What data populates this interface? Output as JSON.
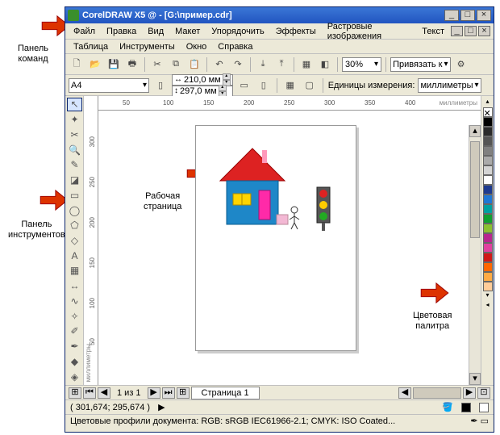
{
  "titlebar": {
    "title": "CorelDRAW X5 @ - [G:\\пример.cdr]"
  },
  "menu": [
    "Файл",
    "Правка",
    "Вид",
    "Макет",
    "Упорядочить",
    "Эффекты",
    "Растровые изображения",
    "Текст",
    "Таблица",
    "Инструменты",
    "Окно",
    "Справка"
  ],
  "toolbar": {
    "zoom": "30%",
    "snap": "Привязать к"
  },
  "propbar": {
    "paper": "A4",
    "width": "210,0 мм",
    "height": "297,0 мм",
    "units_label": "Единицы измерения:",
    "units": "миллиметры"
  },
  "ruler_h": [
    "50",
    "100",
    "150",
    "200",
    "250",
    "300",
    "350",
    "400"
  ],
  "ruler_h_label": "миллиметры",
  "ruler_v": [
    "50",
    "100",
    "150",
    "200",
    "250",
    "300"
  ],
  "ruler_v_label": "миллиметры",
  "pager": {
    "page_count": "1 из 1",
    "tab": "Страница 1"
  },
  "status": {
    "coords": "( 301,674; 295,674 )"
  },
  "status2": "Цветовые профили документа: RGB: sRGB IEC61966-2.1; CMYK: ISO Coated...",
  "palette": [
    "#ffffff",
    "#000000",
    "#2b2b2b",
    "#555555",
    "#808080",
    "#aaaaaa",
    "#d4d4d4",
    "#1f77d4",
    "#20a02a",
    "#c01818",
    "#009999",
    "#1122cc",
    "#22aa22",
    "#ff66cc",
    "#cc00cc",
    "#ff8800",
    "#ffcc66"
  ],
  "fill_swatches": [
    "#000000",
    "#ffffff"
  ],
  "toolbox_names": [
    "pick",
    "shape",
    "crop",
    "zoom",
    "freehand",
    "smart-fill",
    "rectangle",
    "ellipse",
    "polygon",
    "basic-shapes",
    "text",
    "table",
    "dimension",
    "connector",
    "interactive",
    "eyedropper",
    "outline",
    "fill",
    "interactive-fill"
  ],
  "annotations": {
    "commands_panel": "Панель\nкоманд",
    "tools_panel": "Панель\nинструментов",
    "work_page": "Рабочая\nстраница",
    "color_palette": "Цветовая\nпалитра"
  }
}
